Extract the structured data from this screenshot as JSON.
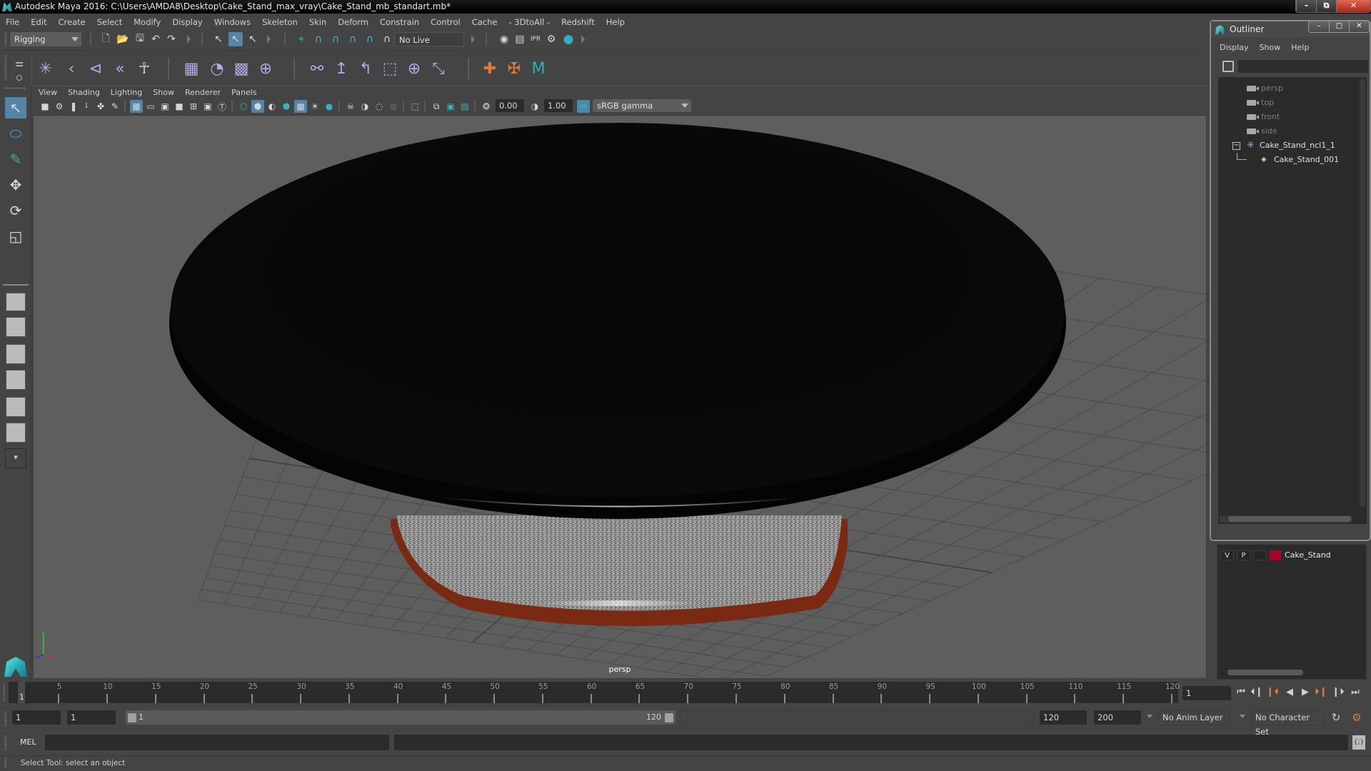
{
  "window": {
    "title": "Autodesk Maya 2016: C:\\Users\\AMDA8\\Desktop\\Cake_Stand_max_vray\\Cake_Stand_mb_standart.mb*",
    "minimize": "–",
    "maximize": "⧉",
    "close": "✕"
  },
  "menubar": [
    "File",
    "Edit",
    "Create",
    "Select",
    "Modify",
    "Display",
    "Windows",
    "Skeleton",
    "Skin",
    "Deform",
    "Constrain",
    "Control",
    "Cache",
    "- 3DtoAll -",
    "Redshift",
    "Help"
  ],
  "statusline": {
    "menuset": "Rigging",
    "live_surface": "No Live Surface"
  },
  "shelf": {
    "icons": [
      "joint-tool-icon",
      "insert-joint-icon",
      "mirror-joint-icon",
      "ik-handle-icon",
      "humanik-icon",
      "skin-bind-icon",
      "paint-weights-icon",
      "lattice-icon",
      "cluster-icon",
      "parent-constraint-icon",
      "point-constraint-icon",
      "orient-constraint-icon",
      "scale-constraint-icon",
      "aim-constraint-icon",
      "pole-vector-icon",
      "locator-icon",
      "ik-fk-icon",
      "maya-logo-icon"
    ]
  },
  "viewport": {
    "panel_menu": [
      "View",
      "Shading",
      "Lighting",
      "Show",
      "Renderer",
      "Panels"
    ],
    "exposure": "0.00",
    "gamma": "1.00",
    "color_space": "sRGB gamma",
    "camera_label": "persp",
    "axis": {
      "x": "x",
      "y": "y",
      "z": "z"
    },
    "colors": {
      "background": "#5e5e5e",
      "grid": "#4a4a4a",
      "top_plate": "#050505",
      "base_speckle": "#9a9a9a",
      "base_rim": "#7a2a12"
    }
  },
  "toolbox": {
    "tools": [
      "select-tool",
      "lasso-tool",
      "paint-select-tool",
      "move-tool",
      "rotate-tool",
      "scale-tool"
    ]
  },
  "outliner": {
    "title": "Outliner",
    "menu": [
      "Display",
      "Show",
      "Help"
    ],
    "items": [
      {
        "name": "persp",
        "type": "camera",
        "dim": true
      },
      {
        "name": "top",
        "type": "camera",
        "dim": true
      },
      {
        "name": "front",
        "type": "camera",
        "dim": true
      },
      {
        "name": "side",
        "type": "camera",
        "dim": true
      },
      {
        "name": "Cake_Stand_ncl1_1",
        "type": "group",
        "dim": false
      },
      {
        "name": "Cake_Stand_001",
        "type": "mesh",
        "dim": false
      }
    ]
  },
  "layers": {
    "rows": [
      {
        "v": "V",
        "p": "P",
        "color": "#a3082a",
        "name": "Cake_Stand"
      }
    ]
  },
  "timeline": {
    "ticks": [
      5,
      10,
      15,
      20,
      25,
      30,
      35,
      40,
      45,
      50,
      55,
      60,
      65,
      70,
      75,
      80,
      85,
      90,
      95,
      100,
      105,
      110,
      115,
      120
    ],
    "start": 1,
    "end": 120,
    "current_frame": "1",
    "current_frame_field": "1"
  },
  "range": {
    "start_field": "1",
    "playback_start": "1",
    "slider_start": "1",
    "slider_end": "120",
    "playback_end": "120",
    "end_field": "200",
    "anim_layer": "No Anim Layer",
    "character_set": "No Character Set"
  },
  "cmdline": {
    "label": "MEL"
  },
  "status": {
    "message": "Select Tool: select an object"
  }
}
